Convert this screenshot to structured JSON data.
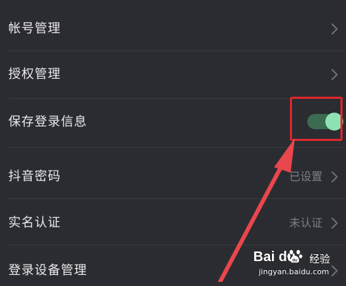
{
  "settings": {
    "items": [
      {
        "label": "帐号管理",
        "value": ""
      },
      {
        "label": "授权管理",
        "value": ""
      },
      {
        "label": "保存登录信息",
        "value": ""
      },
      {
        "label": "抖音密码",
        "value": "已设置"
      },
      {
        "label": "实名认证",
        "value": "未认证"
      },
      {
        "label": "登录设备管理",
        "value": ""
      }
    ],
    "save_login_enabled": true
  },
  "colors": {
    "background": "#2b2c31",
    "toggle_track": "#3c6b52",
    "toggle_knob": "#8ee3b5",
    "annotation": "#e0262c"
  },
  "watermark": {
    "brand": "Bai du",
    "brand_cn": "经验",
    "url": "jingyan.baidu.com"
  }
}
